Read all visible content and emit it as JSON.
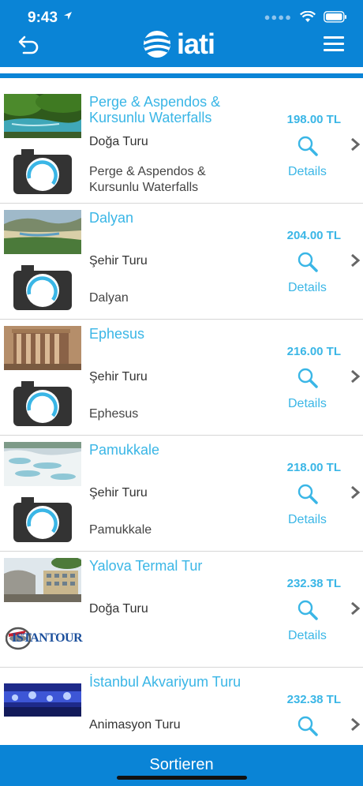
{
  "status_bar": {
    "time": "9:43"
  },
  "colors": {
    "brand": "#0a84d6",
    "accent": "#3ab6e6"
  },
  "nav": {
    "logo_text": "iati",
    "back_icon": "back-arrow-icon",
    "menu_icon": "hamburger-menu-icon"
  },
  "tours": [
    {
      "title": "Perge & Aspendos & Kursunlu Waterfalls",
      "type": "Doğa Turu",
      "description": "Perge & Aspendos & Kursunlu Waterfalls",
      "price": "198.00 TL",
      "details": "Details",
      "thumb": "waterfall"
    },
    {
      "title": "Dalyan",
      "type": "Şehir Turu",
      "description": "Dalyan",
      "price": "204.00 TL",
      "details": "Details",
      "thumb": "coast"
    },
    {
      "title": "Ephesus",
      "type": "Şehir Turu",
      "description": "Ephesus",
      "price": "216.00 TL",
      "details": "Details",
      "thumb": "ruins"
    },
    {
      "title": "Pamukkale",
      "type": "Şehir Turu",
      "description": "Pamukkale",
      "price": "218.00 TL",
      "details": "Details",
      "thumb": "terraces"
    },
    {
      "title": "Yalova Termal Tur",
      "type": "Doğa Turu",
      "description": "",
      "price": "232.38 TL",
      "details": "Details",
      "thumb": "hotel",
      "logo": "ISTANTOUR"
    },
    {
      "title": "İstanbul Akvariyum Turu",
      "type": "Animasyon Turu",
      "description": "",
      "price": "232.38 TL",
      "details": "",
      "thumb": "aquarium"
    }
  ],
  "footer": {
    "sort_label": "Sortieren"
  }
}
